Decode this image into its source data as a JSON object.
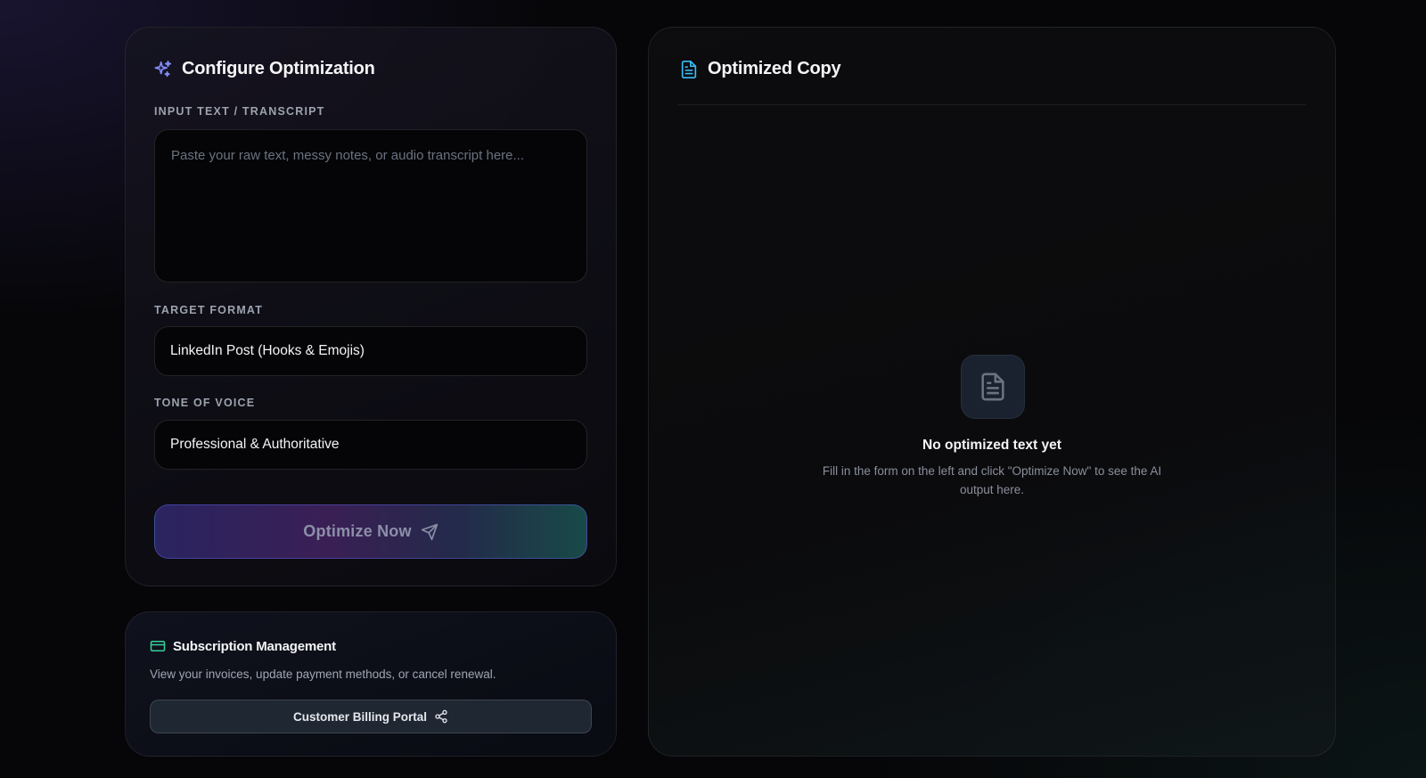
{
  "config": {
    "title": "Configure Optimization",
    "title_icon": "sparkles-icon",
    "input_label": "INPUT TEXT / TRANSCRIPT",
    "input_placeholder": "Paste your raw text, messy notes, or audio transcript here...",
    "input_value": "",
    "format_label": "TARGET FORMAT",
    "format_value": "LinkedIn Post (Hooks & Emojis)",
    "tone_label": "TONE OF VOICE",
    "tone_value": "Professional & Authoritative",
    "submit_label": "Optimize Now",
    "submit_icon": "send-icon"
  },
  "billing": {
    "title": "Subscription Management",
    "title_icon": "credit-card-icon",
    "description": "View your invoices, update payment methods, or cancel renewal.",
    "portal_label": "Customer Billing Portal",
    "portal_icon": "share-icon"
  },
  "output": {
    "title": "Optimized Copy",
    "title_icon": "document-icon",
    "empty_icon": "document-icon",
    "empty_title": "No optimized text yet",
    "empty_description": "Fill in the form on the left and click \"Optimize Now\" to see the AI output here."
  },
  "colors": {
    "accent_purple": "#818cf8",
    "accent_cyan": "#38bdf8",
    "accent_green": "#34d399"
  }
}
